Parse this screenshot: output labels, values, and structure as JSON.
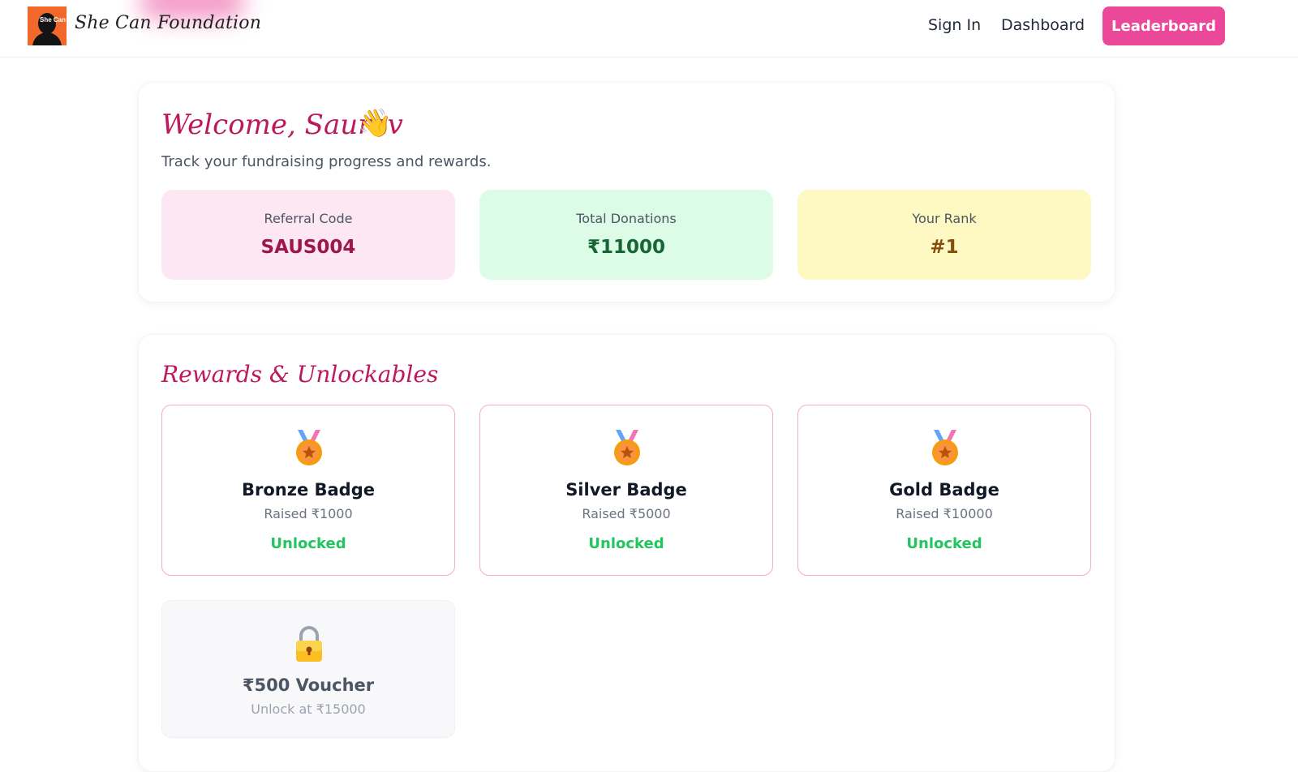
{
  "navbar": {
    "brand_name": "She Can Foundation",
    "logo_text": "She Can",
    "links": {
      "signin": "Sign In",
      "dashboard": "Dashboard",
      "leaderboard": "Leaderboard"
    }
  },
  "welcome": {
    "title": "Welcome, Saurav",
    "wave_icon": "👋",
    "subtitle": "Track your fundraising progress and rewards.",
    "stats": {
      "referral": {
        "label": "Referral Code",
        "value": "SAUS004"
      },
      "donations": {
        "label": "Total Donations",
        "value": "₹11000"
      },
      "rank": {
        "label": "Your Rank",
        "value": "#1"
      }
    }
  },
  "rewards": {
    "title": "Rewards & Unlockables",
    "badges": [
      {
        "name": "Bronze Badge",
        "requirement": "Raised ₹1000",
        "status": "Unlocked"
      },
      {
        "name": "Silver Badge",
        "requirement": "Raised ₹5000",
        "status": "Unlocked"
      },
      {
        "name": "Gold Badge",
        "requirement": "Raised ₹10000",
        "status": "Unlocked"
      }
    ],
    "locked": {
      "name": "₹500 Voucher",
      "requirement": "Unlock at ₹15000"
    }
  },
  "colors": {
    "accent": "#ec4899",
    "title": "#be185d",
    "unlocked": "#22c55e"
  },
  "icons": {
    "medal": "medal-icon",
    "lock": "lock-icon",
    "wave": "waving-hand-icon"
  }
}
